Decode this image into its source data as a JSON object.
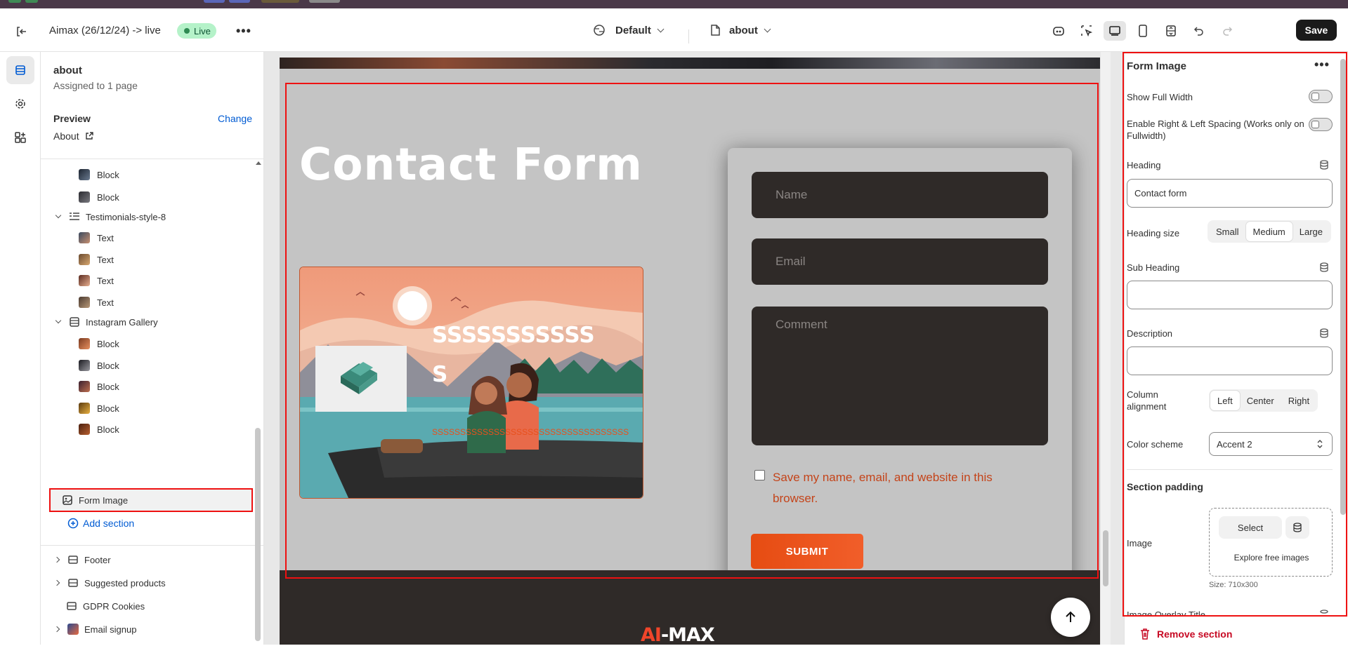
{
  "header": {
    "theme_name": "Aimax (26/12/24) -> live",
    "status": "Live",
    "template": "Default",
    "page": "about",
    "save_label": "Save"
  },
  "sidebar": {
    "title": "about",
    "subtitle": "Assigned to 1 page",
    "preview_label": "Preview",
    "change_label": "Change",
    "preview_page": "About",
    "tree": [
      {
        "label": "Block",
        "level": 2
      },
      {
        "label": "Block",
        "level": 2
      },
      {
        "label": "Testimonials-style-8",
        "level": 1
      },
      {
        "label": "Text",
        "level": 2
      },
      {
        "label": "Text",
        "level": 2
      },
      {
        "label": "Text",
        "level": 2
      },
      {
        "label": "Text",
        "level": 2
      },
      {
        "label": "Instagram Gallery",
        "level": 1
      },
      {
        "label": "Block",
        "level": 2
      },
      {
        "label": "Block",
        "level": 2
      },
      {
        "label": "Block",
        "level": 2
      },
      {
        "label": "Block",
        "level": 2
      },
      {
        "label": "Block",
        "level": 2
      }
    ],
    "selected": "Form Image",
    "add_section": "Add section",
    "footer_groups": [
      "Footer",
      "Suggested products",
      "GDPR Cookies",
      "Email signup"
    ]
  },
  "canvas": {
    "heading": "Contact Form",
    "image_text_1": "SSSSSSSSSSS",
    "image_text_2": "S",
    "image_text_3": "SSSSSSSSSSSSSSSSSSSSSSSSSSSSSSSSSSS",
    "name_placeholder": "Name",
    "email_placeholder": "Email",
    "comment_placeholder": "Comment",
    "consent": "Save my name, email, and website in this browser.",
    "submit": "SUBMIT",
    "footer_logo_a": "AI",
    "footer_logo_b": "-MAX"
  },
  "settings": {
    "title": "Form Image",
    "show_full_width": "Show Full Width",
    "spacing": "Enable Right & Left Spacing (Works only on Fullwidth)",
    "heading_label": "Heading",
    "heading_value": "Contact form",
    "heading_size_label": "Heading size",
    "heading_sizes": [
      "Small",
      "Medium",
      "Large"
    ],
    "sub_heading_label": "Sub Heading",
    "description_label": "Description",
    "column_alignment_label": "Column alignment",
    "alignments": [
      "Left",
      "Center",
      "Right"
    ],
    "color_scheme_label": "Color scheme",
    "color_scheme_value": "Accent 2",
    "section_padding": "Section padding",
    "image_label": "Image",
    "select_label": "Select",
    "explore_label": "Explore free images",
    "size_note": "Size: 710x300",
    "overlay_label": "Image Overlay Title",
    "remove_label": "Remove section"
  },
  "colors": {
    "accent": "#005bd3",
    "submit": "#e64c12",
    "danger": "#c70a24",
    "live": "#b5f2c9"
  }
}
